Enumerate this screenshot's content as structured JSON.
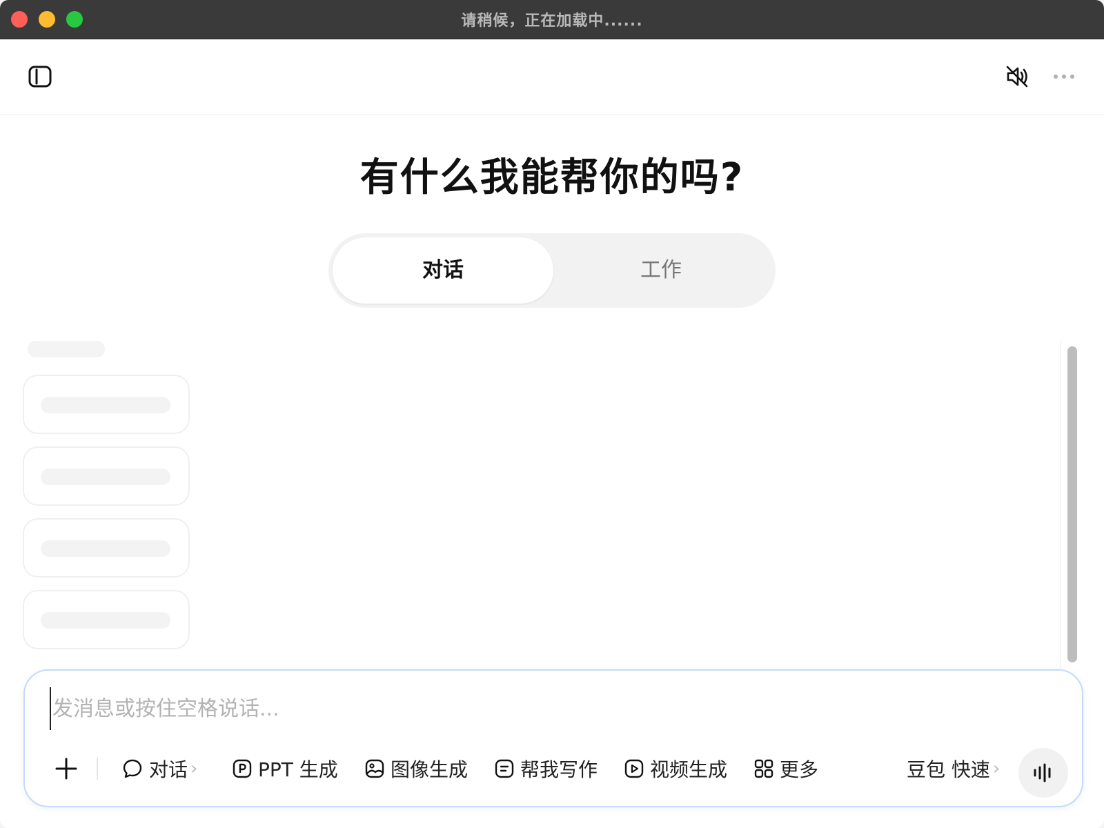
{
  "window": {
    "title": "请稍候，正在加载中......"
  },
  "topbar": {
    "left_icon": "sidebar-toggle-icon",
    "right_icons": [
      "speaker-muted-icon",
      "more-dots-icon"
    ]
  },
  "hero": {
    "title": "有什么我能帮你的吗?"
  },
  "mode_switch": {
    "tabs": [
      {
        "label": "对话",
        "active": true
      },
      {
        "label": "工作",
        "active": false
      }
    ]
  },
  "composer": {
    "placeholder": "发消息或按住空格说话...",
    "tools": [
      {
        "label": "对话",
        "icon": "chat-bubble-icon",
        "has_chevron": true
      },
      {
        "label": "PPT 生成",
        "icon": "ppt-icon"
      },
      {
        "label": "图像生成",
        "icon": "image-icon"
      },
      {
        "label": "帮我写作",
        "icon": "writing-icon"
      },
      {
        "label": "视频生成",
        "icon": "video-icon"
      },
      {
        "label": "更多",
        "icon": "grid-icon"
      }
    ],
    "model_selector": {
      "label": "豆包 快速"
    },
    "chevron": "›"
  },
  "colors": {
    "titlebar": "#3a3a3a",
    "traffic_red": "#fe5f57",
    "traffic_yellow": "#febc2e",
    "traffic_green": "#28c840",
    "composer_border": "#c5daf7"
  }
}
